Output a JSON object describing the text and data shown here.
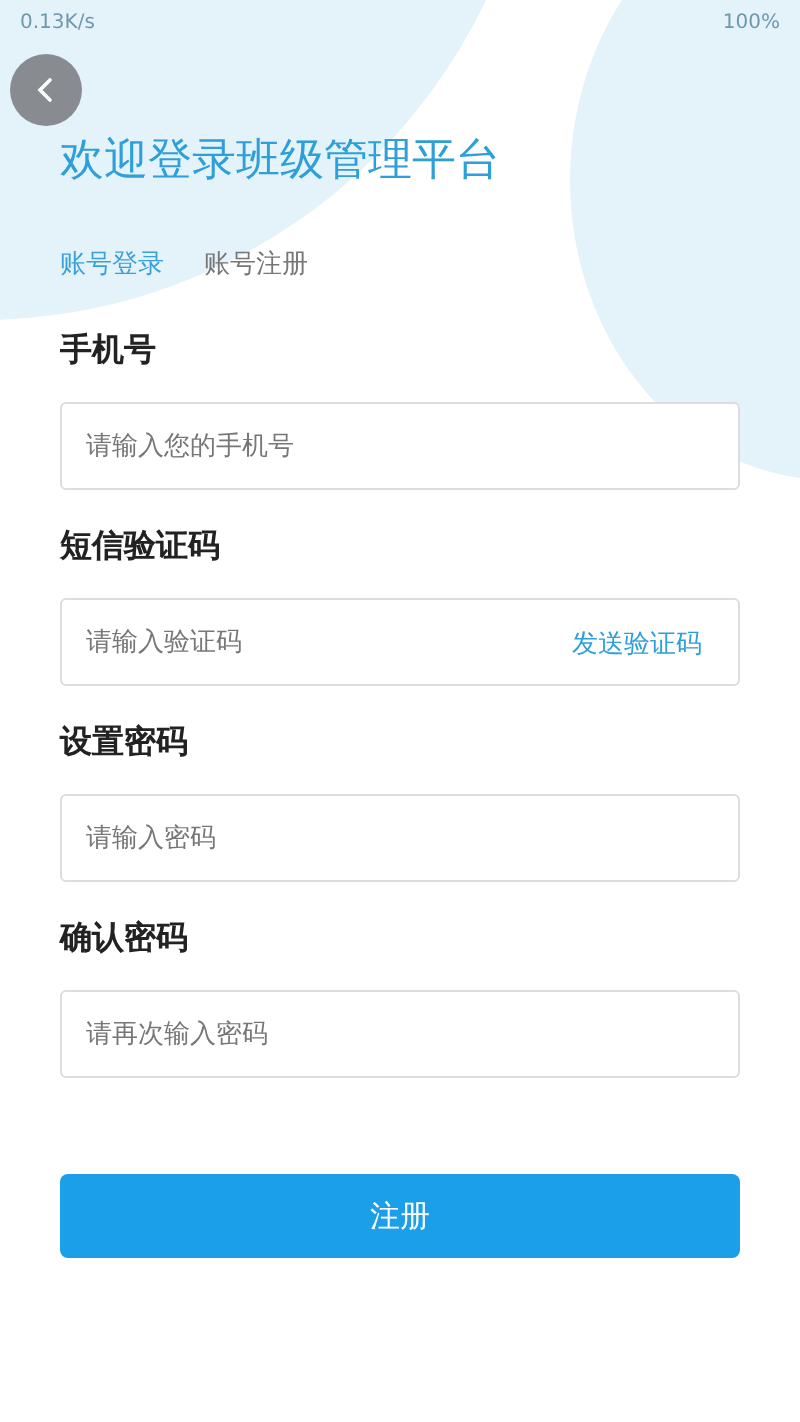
{
  "status_bar": {
    "network_speed": "0.13K/s",
    "battery": "100%"
  },
  "title": "欢迎登录班级管理平台",
  "tabs": [
    {
      "label": "账号登录",
      "selected": true
    },
    {
      "label": "账号注册",
      "selected": false
    }
  ],
  "fields": [
    {
      "label": "手机号",
      "placeholder": "请输入您的手机号"
    },
    {
      "label": "短信验证码",
      "placeholder": "请输入验证码",
      "action": "发送验证码"
    },
    {
      "label": "设置密码",
      "placeholder": "请输入密码"
    },
    {
      "label": "确认密码",
      "placeholder": "请再次输入密码"
    }
  ],
  "submit": "注册"
}
